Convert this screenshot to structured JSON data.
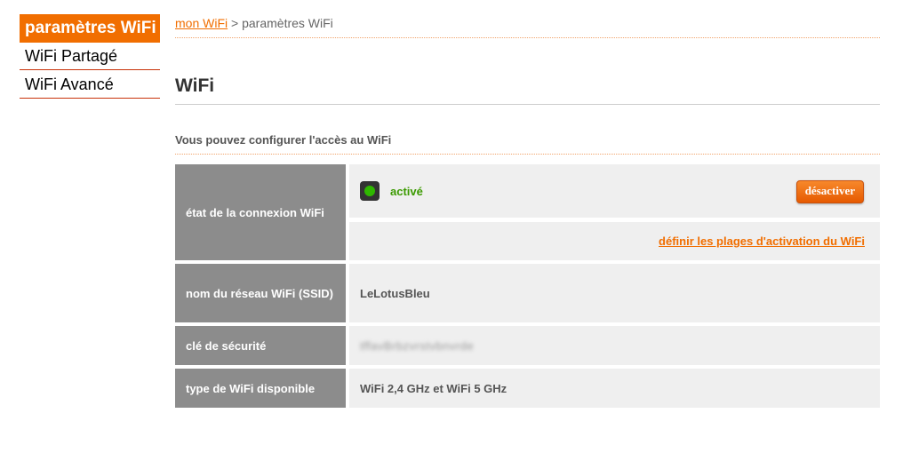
{
  "sidebar": {
    "items": [
      {
        "label": "paramètres WiFi"
      },
      {
        "label": "WiFi Partagé"
      },
      {
        "label": "WiFi Avancé"
      }
    ]
  },
  "breadcrumb": {
    "link": "mon WiFi",
    "separator": " > ",
    "current": "paramètres WiFi"
  },
  "page": {
    "title": "WiFi",
    "intro": "Vous pouvez configurer l'accès au WiFi"
  },
  "connection": {
    "label": "état de la connexion WiFi",
    "status": "activé",
    "button": "désactiver",
    "schedule_link": "définir les plages d'activation du WiFi"
  },
  "ssid": {
    "label": "nom du réseau WiFi (SSID)",
    "value": "LeLotusBleu"
  },
  "security_key": {
    "label": "clé de sécurité",
    "value": "tffavBrbzvrstvbnvrde"
  },
  "wifi_type": {
    "label": "type de WiFi disponible",
    "value": "WiFi 2,4 GHz et WiFi 5 GHz"
  },
  "colors": {
    "accent": "#f16e00",
    "status_green": "#3b9a00",
    "label_bg": "#8c8c8c",
    "value_bg": "#efefef"
  },
  "icons": {
    "status": "status-led-icon"
  }
}
